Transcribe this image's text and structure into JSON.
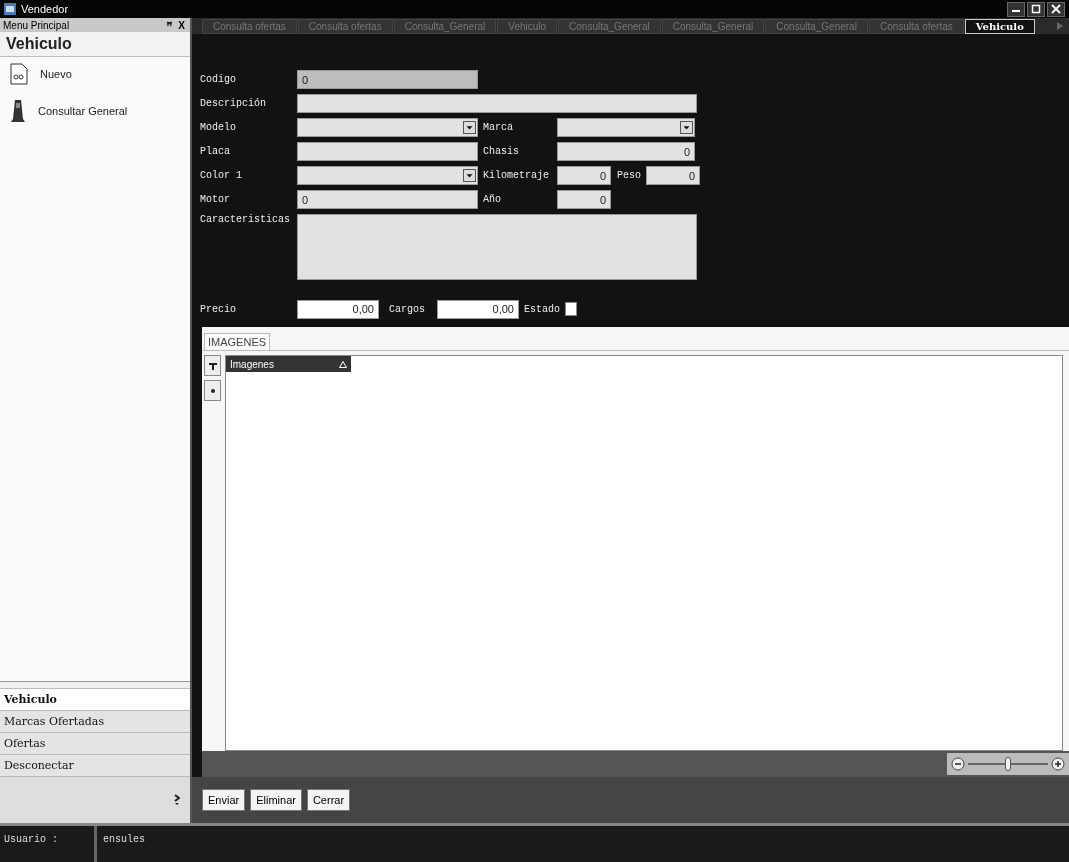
{
  "window": {
    "title": "Vendedor"
  },
  "sidebar": {
    "title": "Menu Principal",
    "pin": "ꟸ",
    "close": "X",
    "section": "Vehiculo",
    "items": [
      {
        "label": "Nuevo",
        "kind": "new"
      },
      {
        "label": "Consultar General",
        "kind": "search"
      }
    ],
    "nav": [
      {
        "label": "Vehiculo",
        "selected": true
      },
      {
        "label": "Marcas Ofertadas",
        "selected": false
      },
      {
        "label": "Ofertas",
        "selected": false
      },
      {
        "label": "Desconectar",
        "selected": false
      }
    ]
  },
  "tabs": [
    {
      "label": "Consulta ofertas",
      "selected": false
    },
    {
      "label": "Consulta ofertas",
      "selected": false
    },
    {
      "label": "Consulta_General",
      "selected": false
    },
    {
      "label": "Vehiculo",
      "selected": false
    },
    {
      "label": "Consulta_General",
      "selected": false
    },
    {
      "label": "Consulta_General",
      "selected": false
    },
    {
      "label": "Consulta_General",
      "selected": false
    },
    {
      "label": "Consulta ofertas",
      "selected": false
    },
    {
      "label": "Vehiculo",
      "selected": true
    }
  ],
  "form": {
    "codigo": {
      "label": "Codigo",
      "value": "0"
    },
    "descripcion": {
      "label": "Descripción"
    },
    "modelo": {
      "label": "Modelo"
    },
    "marca": {
      "label": "Marca"
    },
    "placa": {
      "label": "Placa"
    },
    "chasis": {
      "label": "Chasis",
      "value": "0"
    },
    "color": {
      "label": "Color 1"
    },
    "kilometraje": {
      "label": "Kilometraje",
      "value": "0"
    },
    "peso": {
      "label": "Peso",
      "value": "0"
    },
    "motor": {
      "label": "Motor",
      "value": "0"
    },
    "anio": {
      "label": "Año",
      "value": "0"
    },
    "caracteristicas": {
      "label": "Caracteristicas"
    },
    "precio": {
      "label": "Precio",
      "value": "0,00"
    },
    "cargos": {
      "label": "Cargos",
      "value": "0,00"
    },
    "estado": {
      "label": "Estado",
      "checked": false
    }
  },
  "images": {
    "tab": "IMAGENES",
    "column": "Imagenes",
    "zoom": {
      "level": 0.5
    }
  },
  "buttons": [
    "Enviar",
    "Eliminar",
    "Cerrar"
  ],
  "status_bar": {
    "label": "Usuario :",
    "value": "ensules"
  }
}
